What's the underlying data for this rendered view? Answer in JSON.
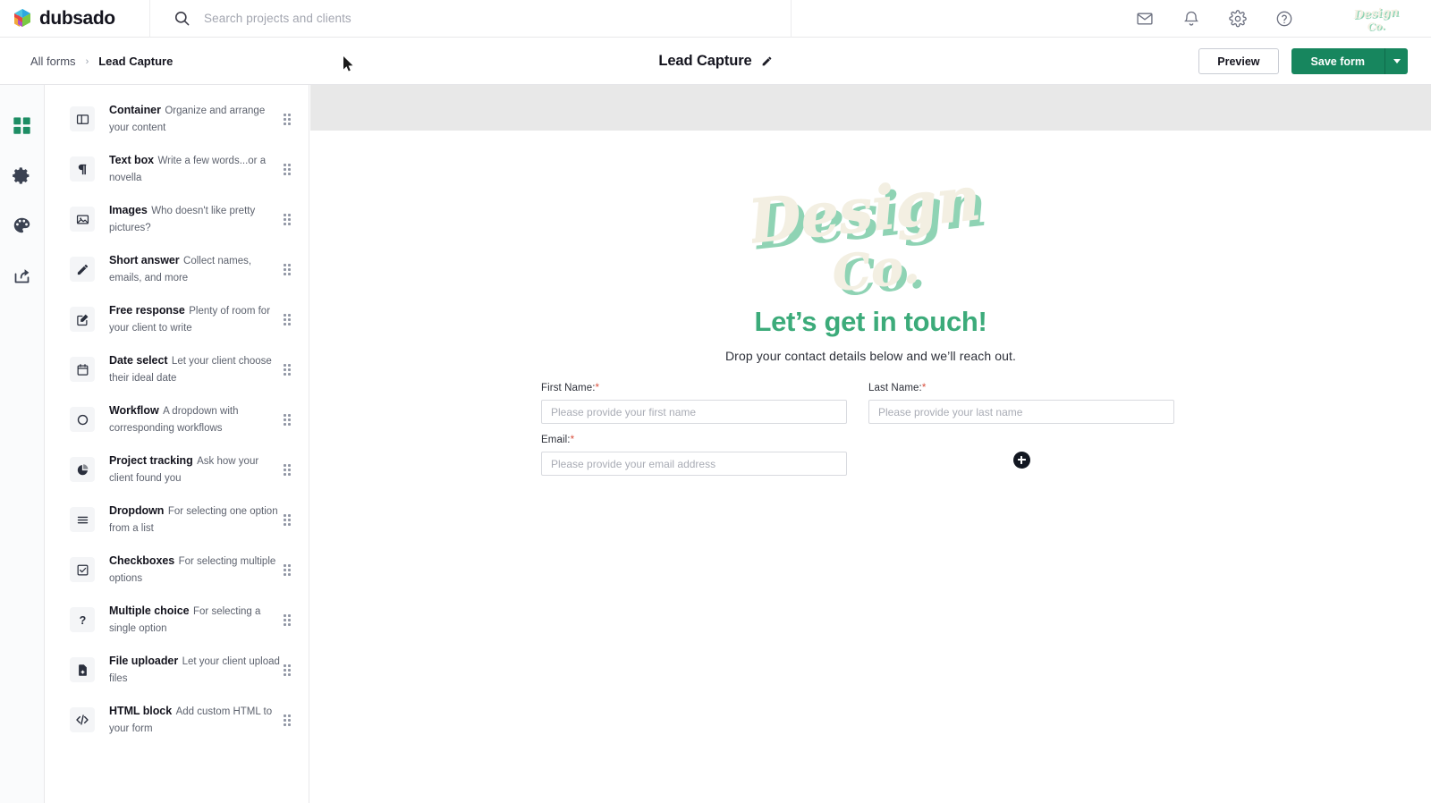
{
  "app": {
    "brand_name": "dubsado",
    "logo_icon": "cube-icon"
  },
  "topnav": {
    "search": {
      "icon": "search-icon",
      "placeholder": "Search projects and clients",
      "value": ""
    },
    "icons": [
      {
        "name": "mail-icon",
        "label": "Mail"
      },
      {
        "name": "bell-icon",
        "label": "Notifications"
      },
      {
        "name": "gear-icon",
        "label": "Settings"
      },
      {
        "name": "help-icon",
        "label": "Help"
      }
    ],
    "account_logo_text_line1": "Design",
    "account_logo_text_line2": "Co."
  },
  "subheader": {
    "breadcrumb": {
      "root": "All forms",
      "separator": "›",
      "current": "Lead Capture"
    },
    "form_title": "Lead Capture",
    "edit_icon": "pencil-icon",
    "preview_label": "Preview",
    "save_label": "Save form",
    "save_caret_icon": "chevron-down-icon",
    "save_color": "#17865e"
  },
  "rail": {
    "items": [
      {
        "name": "sidebar-item-builder",
        "icon": "grid-icon",
        "active": true,
        "color": "#1d8d64"
      },
      {
        "name": "sidebar-item-settings",
        "icon": "gear-icon",
        "active": false,
        "color": "#3b4252"
      },
      {
        "name": "sidebar-item-design",
        "icon": "palette-icon",
        "active": false,
        "color": "#3b4252"
      },
      {
        "name": "sidebar-item-share",
        "icon": "share-icon",
        "active": false,
        "color": "#3b4252"
      }
    ]
  },
  "panel": {
    "components": [
      {
        "title": "Container",
        "sub": "Organize and arrange your content",
        "icon": "container-icon"
      },
      {
        "title": "Text box",
        "sub": "Write a few words...or a novella",
        "icon": "paragraph-icon"
      },
      {
        "title": "Images",
        "sub": "Who doesn't like pretty pictures?",
        "icon": "image-icon"
      },
      {
        "title": "Short answer",
        "sub": "Collect names, emails, and more",
        "icon": "pencil-icon"
      },
      {
        "title": "Free response",
        "sub": "Plenty of room for your client to write",
        "icon": "edit-square-icon"
      },
      {
        "title": "Date select",
        "sub": "Let your client choose their ideal date",
        "icon": "calendar-icon"
      },
      {
        "title": "Workflow",
        "sub": "A dropdown with corresponding workflows",
        "icon": "circle-icon"
      },
      {
        "title": "Project tracking",
        "sub": "Ask how your client found you",
        "icon": "pie-chart-icon"
      },
      {
        "title": "Dropdown",
        "sub": "For selecting one option from a list",
        "icon": "list-icon"
      },
      {
        "title": "Checkboxes",
        "sub": "For selecting multiple options",
        "icon": "checkbox-icon"
      },
      {
        "title": "Multiple choice",
        "sub": "For selecting a single option",
        "icon": "question-icon"
      },
      {
        "title": "File uploader",
        "sub": "Let your client upload files",
        "icon": "file-upload-icon"
      },
      {
        "title": "HTML block",
        "sub": "Add custom HTML to your form",
        "icon": "code-icon"
      }
    ],
    "drag_handle_icon": "drag-handle-icon"
  },
  "canvas": {
    "banner_color": "#e8e8e8",
    "logo": {
      "line1": "Design",
      "line2": "Co.",
      "fill_color": "#f3efe2",
      "shadow_color": "#8fd3b4"
    },
    "headline": "Let’s get in touch!",
    "headline_color": "#3cab7a",
    "subline": "Drop your contact details below and we’ll reach out.",
    "fields": [
      {
        "label": "First Name:",
        "required": true,
        "placeholder": "Please provide your first name",
        "value": "",
        "name": "first-name-field"
      },
      {
        "label": "Last Name:",
        "required": true,
        "placeholder": "Please provide your last name",
        "value": "",
        "name": "last-name-field"
      },
      {
        "label": "Email:",
        "required": true,
        "placeholder": "Please provide your email address",
        "value": "",
        "name": "email-field"
      }
    ],
    "add_button_icon": "plus-icon",
    "required_marker": "*"
  }
}
